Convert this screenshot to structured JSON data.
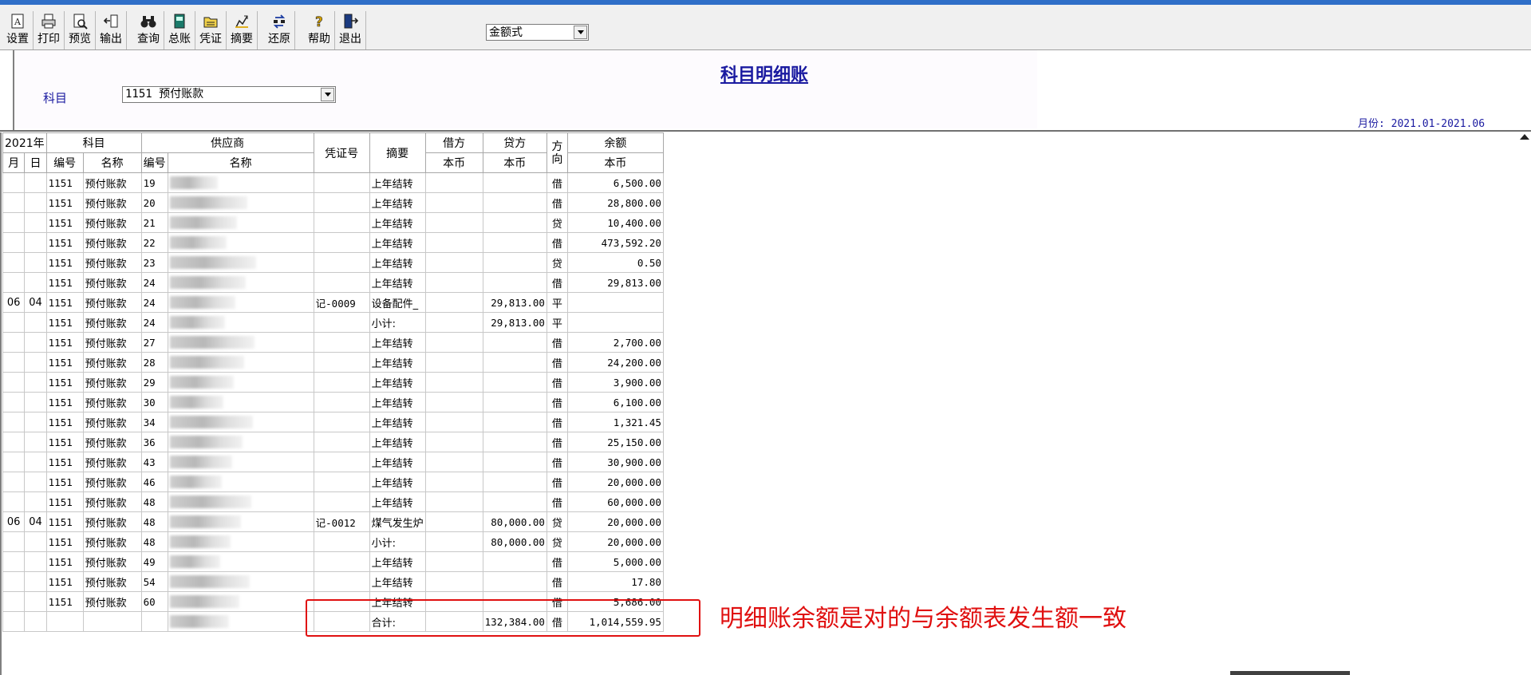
{
  "toolbar": {
    "buttons": [
      {
        "label": "设置",
        "icon": "settings-icon"
      },
      {
        "label": "打印",
        "icon": "printer-icon"
      },
      {
        "label": "预览",
        "icon": "preview-icon"
      },
      {
        "label": "输出",
        "icon": "export-icon"
      },
      {
        "label": "查询",
        "icon": "binoculars-icon"
      },
      {
        "label": "总账",
        "icon": "ledger-book-icon"
      },
      {
        "label": "凭证",
        "icon": "voucher-folder-icon"
      },
      {
        "label": "摘要",
        "icon": "summary-edit-icon"
      },
      {
        "label": "还原",
        "icon": "restore-icon"
      },
      {
        "label": "帮助",
        "icon": "help-icon"
      },
      {
        "label": "退出",
        "icon": "exit-icon"
      }
    ],
    "mode_select": "金额式"
  },
  "header": {
    "title": "科目明细账",
    "subject_label": "科目",
    "subject_value": "1151 预付账款",
    "period": "月份: 2021.01-2021.06"
  },
  "table": {
    "year_header": "2021年",
    "subject_header": "科目",
    "supplier_header": "供应商",
    "voucher_header": "凭证号",
    "summary_header": "摘要",
    "debit_header": "借方",
    "credit_header": "贷方",
    "direction_header": "方向",
    "balance_header": "余额",
    "month": "月",
    "day": "日",
    "code": "编号",
    "name": "名称",
    "supplier_code": "编号",
    "supplier_name": "名称",
    "currency": "本币",
    "rows": [
      {
        "m": "",
        "d": "",
        "code": "1151",
        "name": "预付账款",
        "sc": "19",
        "voucher": "",
        "summary": "上年结转",
        "debit": "",
        "credit": "",
        "dir": "借",
        "balance": "6,500.00"
      },
      {
        "m": "",
        "d": "",
        "code": "1151",
        "name": "预付账款",
        "sc": "20",
        "voucher": "",
        "summary": "上年结转",
        "debit": "",
        "credit": "",
        "dir": "借",
        "balance": "28,800.00"
      },
      {
        "m": "",
        "d": "",
        "code": "1151",
        "name": "预付账款",
        "sc": "21",
        "voucher": "",
        "summary": "上年结转",
        "debit": "",
        "credit": "",
        "dir": "贷",
        "balance": "10,400.00"
      },
      {
        "m": "",
        "d": "",
        "code": "1151",
        "name": "预付账款",
        "sc": "22",
        "voucher": "",
        "summary": "上年结转",
        "debit": "",
        "credit": "",
        "dir": "借",
        "balance": "473,592.20"
      },
      {
        "m": "",
        "d": "",
        "code": "1151",
        "name": "预付账款",
        "sc": "23",
        "voucher": "",
        "summary": "上年结转",
        "debit": "",
        "credit": "",
        "dir": "贷",
        "balance": "0.50"
      },
      {
        "m": "",
        "d": "",
        "code": "1151",
        "name": "预付账款",
        "sc": "24",
        "voucher": "",
        "summary": "上年结转",
        "debit": "",
        "credit": "",
        "dir": "借",
        "balance": "29,813.00"
      },
      {
        "m": "06",
        "d": "04",
        "code": "1151",
        "name": "预付账款",
        "sc": "24",
        "voucher": "记-0009",
        "summary": "设备配件_",
        "debit": "",
        "credit": "29,813.00",
        "dir": "平",
        "balance": ""
      },
      {
        "m": "",
        "d": "",
        "code": "1151",
        "name": "预付账款",
        "sc": "24",
        "voucher": "",
        "summary": "小计:",
        "debit": "",
        "credit": "29,813.00",
        "dir": "平",
        "balance": ""
      },
      {
        "m": "",
        "d": "",
        "code": "1151",
        "name": "预付账款",
        "sc": "27",
        "voucher": "",
        "summary": "上年结转",
        "debit": "",
        "credit": "",
        "dir": "借",
        "balance": "2,700.00"
      },
      {
        "m": "",
        "d": "",
        "code": "1151",
        "name": "预付账款",
        "sc": "28",
        "voucher": "",
        "summary": "上年结转",
        "debit": "",
        "credit": "",
        "dir": "借",
        "balance": "24,200.00"
      },
      {
        "m": "",
        "d": "",
        "code": "1151",
        "name": "预付账款",
        "sc": "29",
        "voucher": "",
        "summary": "上年结转",
        "debit": "",
        "credit": "",
        "dir": "借",
        "balance": "3,900.00"
      },
      {
        "m": "",
        "d": "",
        "code": "1151",
        "name": "预付账款",
        "sc": "30",
        "voucher": "",
        "summary": "上年结转",
        "debit": "",
        "credit": "",
        "dir": "借",
        "balance": "6,100.00"
      },
      {
        "m": "",
        "d": "",
        "code": "1151",
        "name": "预付账款",
        "sc": "34",
        "voucher": "",
        "summary": "上年结转",
        "debit": "",
        "credit": "",
        "dir": "借",
        "balance": "1,321.45"
      },
      {
        "m": "",
        "d": "",
        "code": "1151",
        "name": "预付账款",
        "sc": "36",
        "voucher": "",
        "summary": "上年结转",
        "debit": "",
        "credit": "",
        "dir": "借",
        "balance": "25,150.00"
      },
      {
        "m": "",
        "d": "",
        "code": "1151",
        "name": "预付账款",
        "sc": "43",
        "voucher": "",
        "summary": "上年结转",
        "debit": "",
        "credit": "",
        "dir": "借",
        "balance": "30,900.00"
      },
      {
        "m": "",
        "d": "",
        "code": "1151",
        "name": "预付账款",
        "sc": "46",
        "voucher": "",
        "summary": "上年结转",
        "debit": "",
        "credit": "",
        "dir": "借",
        "balance": "20,000.00"
      },
      {
        "m": "",
        "d": "",
        "code": "1151",
        "name": "预付账款",
        "sc": "48",
        "voucher": "",
        "summary": "上年结转",
        "debit": "",
        "credit": "",
        "dir": "借",
        "balance": "60,000.00"
      },
      {
        "m": "06",
        "d": "04",
        "code": "1151",
        "name": "预付账款",
        "sc": "48",
        "voucher": "记-0012",
        "summary": "煤气发生炉",
        "debit": "",
        "credit": "80,000.00",
        "dir": "贷",
        "balance": "20,000.00"
      },
      {
        "m": "",
        "d": "",
        "code": "1151",
        "name": "预付账款",
        "sc": "48",
        "voucher": "",
        "summary": "小计:",
        "debit": "",
        "credit": "80,000.00",
        "dir": "贷",
        "balance": "20,000.00"
      },
      {
        "m": "",
        "d": "",
        "code": "1151",
        "name": "预付账款",
        "sc": "49",
        "voucher": "",
        "summary": "上年结转",
        "debit": "",
        "credit": "",
        "dir": "借",
        "balance": "5,000.00"
      },
      {
        "m": "",
        "d": "",
        "code": "1151",
        "name": "预付账款",
        "sc": "54",
        "voucher": "",
        "summary": "上年结转",
        "debit": "",
        "credit": "",
        "dir": "借",
        "balance": "17.80"
      },
      {
        "m": "",
        "d": "",
        "code": "1151",
        "name": "预付账款",
        "sc": "60",
        "voucher": "",
        "summary": "上年结转",
        "debit": "",
        "credit": "",
        "dir": "借",
        "balance": "5,686.00"
      },
      {
        "m": "",
        "d": "",
        "code": "",
        "name": "",
        "sc": "",
        "voucher": "",
        "summary": "合计:",
        "debit": "",
        "credit": "132,384.00",
        "dir": "借",
        "balance": "1,014,559.95"
      }
    ]
  },
  "annotation": "明细账余额是对的与余额表发生额一致",
  "colors": {
    "accent": "#1a1aa0",
    "annotation": "#e01010",
    "titlebar": "#2f6fc8"
  }
}
